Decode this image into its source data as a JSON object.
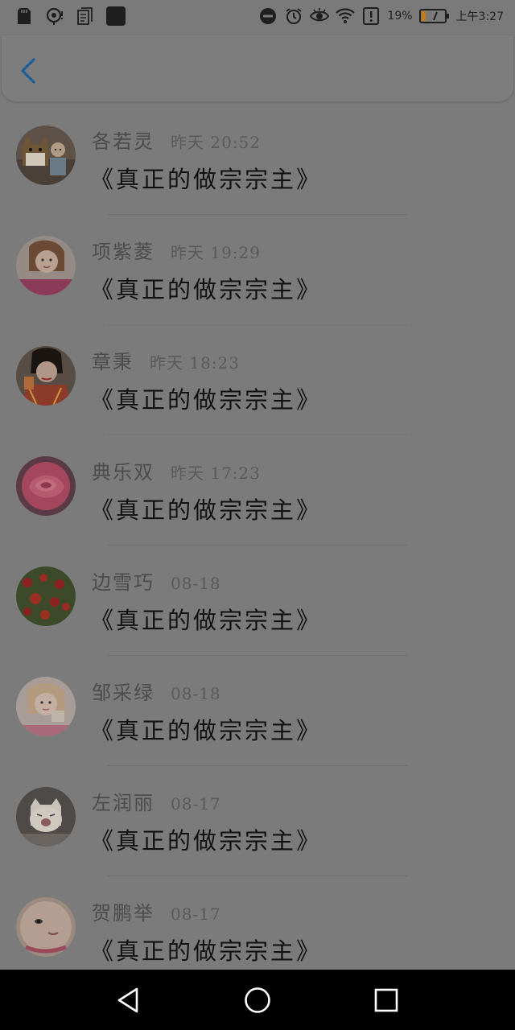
{
  "status_bar": {
    "left_icons": [
      "sd-card-icon",
      "location-icon",
      "document-icon",
      "app-icon"
    ],
    "right_icons": [
      "do-not-disturb-icon",
      "alarm-icon",
      "eye-icon",
      "wifi-icon",
      "alert-icon"
    ],
    "battery_percent": "19%",
    "battery_level": 0.19,
    "time": "上午3:27"
  },
  "header": {
    "back_icon": "chevron-left-icon",
    "accent_color": "#1a5f9a"
  },
  "list": [
    {
      "name": "各若灵",
      "time": "昨天 20:52",
      "content": "《真正的做宗宗主》",
      "avatar": "dog-and-baby"
    },
    {
      "name": "项紫菱",
      "time": "昨天 19:29",
      "content": "《真正的做宗宗主》",
      "avatar": "woman-portrait"
    },
    {
      "name": "章秉",
      "time": "昨天 18:23",
      "content": "《真正的做宗宗主》",
      "avatar": "woman-red-kimono"
    },
    {
      "name": "典乐双",
      "time": "昨天 17:23",
      "content": "《真正的做宗宗主》",
      "avatar": "pink-rose"
    },
    {
      "name": "边雪巧",
      "time": "08-18",
      "content": "《真正的做宗宗主》",
      "avatar": "red-flowers"
    },
    {
      "name": "邹采绿",
      "time": "08-18",
      "content": "《真正的做宗宗主》",
      "avatar": "girl-portrait"
    },
    {
      "name": "左润丽",
      "time": "08-17",
      "content": "《真正的做宗宗主》",
      "avatar": "white-cat"
    },
    {
      "name": "贺鹏举",
      "time": "08-17",
      "content": "《真正的做宗宗主》",
      "avatar": "face-closeup"
    }
  ],
  "nav_bar": {
    "icons": [
      "back-triangle-icon",
      "home-circle-icon",
      "recents-square-icon"
    ]
  }
}
